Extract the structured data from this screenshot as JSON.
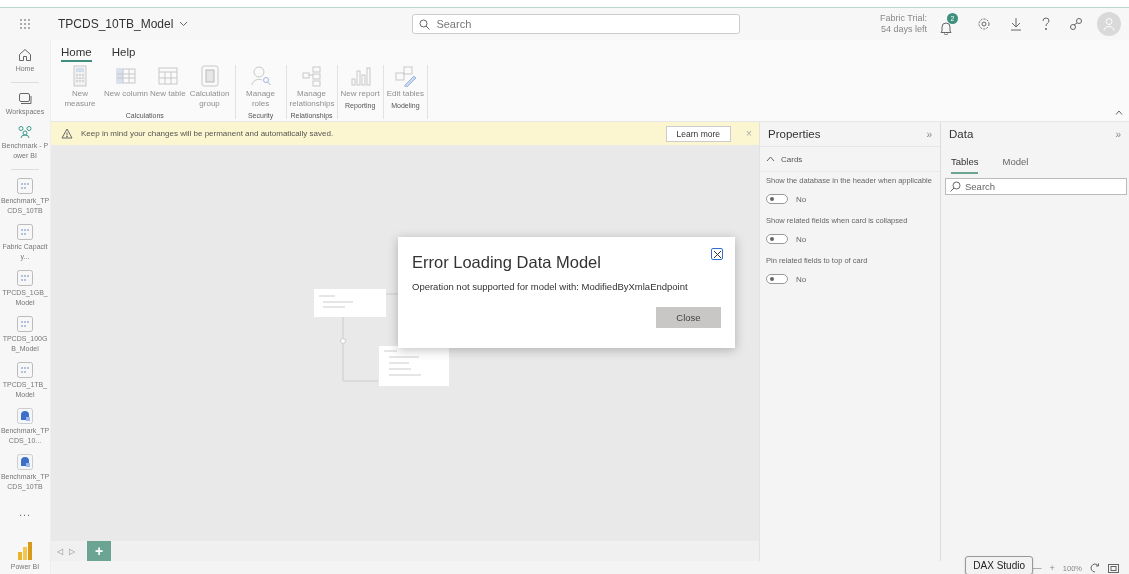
{
  "header": {
    "title": "TPCDS_10TB_Model",
    "search": {
      "placeholder": "Search"
    },
    "trial": [
      "Fabric Trial:",
      "54 days left"
    ],
    "notifications": "2"
  },
  "rail": [
    {
      "kind": "home",
      "label": "Home"
    },
    {
      "kind": "workspaces",
      "label": "Workspaces"
    },
    {
      "kind": "group",
      "label": "Benchmark - Power BI"
    },
    {
      "kind": "model",
      "label": "Benchmark_TPCDS_10TB"
    },
    {
      "kind": "model",
      "label": "Fabric Capacity..."
    },
    {
      "kind": "model",
      "label": "TPCDS_1GB_Model"
    },
    {
      "kind": "model",
      "label": "TPCDS_100GB_Model"
    },
    {
      "kind": "model",
      "label": "TPCDS_1TB_Model"
    },
    {
      "kind": "report",
      "label": "Benchmark_TPCDS_10..."
    },
    {
      "kind": "report",
      "label": "Benchmark_TPCDS_10TB"
    },
    {
      "kind": "more",
      "label": "..."
    },
    {
      "kind": "app",
      "label": "Power BI"
    }
  ],
  "ribbon": {
    "tabs": [
      {
        "label": "Home",
        "selected": true
      },
      {
        "label": "Help",
        "selected": false
      }
    ],
    "groups": [
      {
        "label": "Calculations",
        "buttons": [
          {
            "label": "New measure",
            "disabled": true
          },
          {
            "label": "New column",
            "disabled": true
          },
          {
            "label": "New table",
            "disabled": true
          },
          {
            "label": "Calculation group",
            "disabled": true
          }
        ]
      },
      {
        "label": "Security",
        "buttons": [
          {
            "label": "Manage roles",
            "disabled": true
          }
        ]
      },
      {
        "label": "Relationships",
        "buttons": [
          {
            "label": "Manage relationships",
            "disabled": true
          }
        ]
      },
      {
        "label": "Reporting",
        "buttons": [
          {
            "label": "New report",
            "disabled": true
          }
        ]
      },
      {
        "label": "Modeling",
        "buttons": [
          {
            "label": "Edit tables",
            "disabled": true
          }
        ]
      }
    ]
  },
  "banner": {
    "text": "Keep in mind your changes will be permanent and automatically saved.",
    "button": "Learn more",
    "close": "×"
  },
  "dialog": {
    "title": "Error Loading Data Model",
    "message": "Operation not supported for model with: ModifiedByXmlaEndpoint",
    "button": "Close"
  },
  "canvas_tabs": {
    "prev": "◁",
    "next": "▷",
    "add": "+"
  },
  "properties": {
    "title": "Properties",
    "collapse": "»",
    "section": {
      "label": "Cards",
      "expanded": true
    },
    "settings": [
      {
        "label": "Show the database in the header when applicable",
        "on": false,
        "value": "No"
      },
      {
        "label": "Show related fields when card is collapsed",
        "on": false,
        "value": "No"
      },
      {
        "label": "Pin related fields to top of card",
        "on": false,
        "value": "No"
      }
    ]
  },
  "data": {
    "title": "Data",
    "collapse": "»",
    "tabs": [
      {
        "label": "Tables",
        "selected": true
      },
      {
        "label": "Model",
        "selected": false
      }
    ],
    "search": {
      "placeholder": "Search"
    }
  },
  "status_bar": {
    "tooltip": "DAX Studio",
    "zoom_out": "—",
    "zoom_in": "+",
    "zoom": "100%"
  }
}
